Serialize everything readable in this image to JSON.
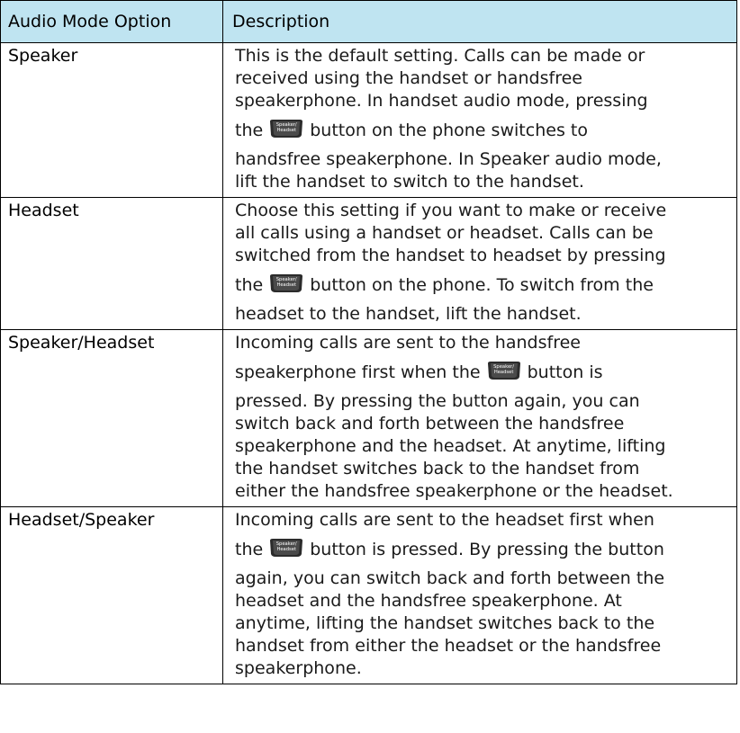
{
  "table": {
    "headers": [
      "Audio Mode Option",
      "Description"
    ],
    "key_label": [
      "Speaker/",
      "Headset"
    ],
    "rows": [
      {
        "option": "Speaker",
        "lines": [
          "This is the default setting. Calls can be made or",
          "received using the handset or handsfree",
          "speakerphone. In handset audio mode, pressing",
          "the",
          "button on the phone switches to",
          "handsfree speakerphone. In Speaker audio mode,",
          "lift the handset to switch to the handset."
        ]
      },
      {
        "option": "Headset",
        "lines": [
          "Choose this setting if you want to make or receive",
          "all calls using a handset or headset. Calls can be",
          "switched from the handset to headset by pressing",
          "the",
          "button on the phone. To switch from the",
          "headset to the handset, lift the handset."
        ]
      },
      {
        "option": "Speaker/Headset",
        "lines": [
          "Incoming calls are sent to the handsfree",
          "speakerphone first when the",
          "button is",
          "pressed. By pressing the button again, you can",
          "switch back and forth between the handsfree",
          "speakerphone and the headset. At anytime, lifting",
          "the handset switches back to the handset from",
          "either the handsfree speakerphone or the headset."
        ]
      },
      {
        "option": "Headset/Speaker",
        "lines": [
          "Incoming calls are sent to the headset first when",
          "the",
          "button is pressed. By pressing the button",
          "again, you can switch back and forth between the",
          "headset and the handsfree speakerphone. At",
          "anytime, lifting the handset switches back to the",
          "handset from either the headset or the handsfree",
          "speakerphone."
        ]
      }
    ]
  },
  "colors": {
    "header_background": "#bfe4f1",
    "border": "#000000",
    "key_body": "#2b2b2b"
  },
  "icons": {
    "speaker_headset_key": "speaker-headset-key-icon"
  }
}
